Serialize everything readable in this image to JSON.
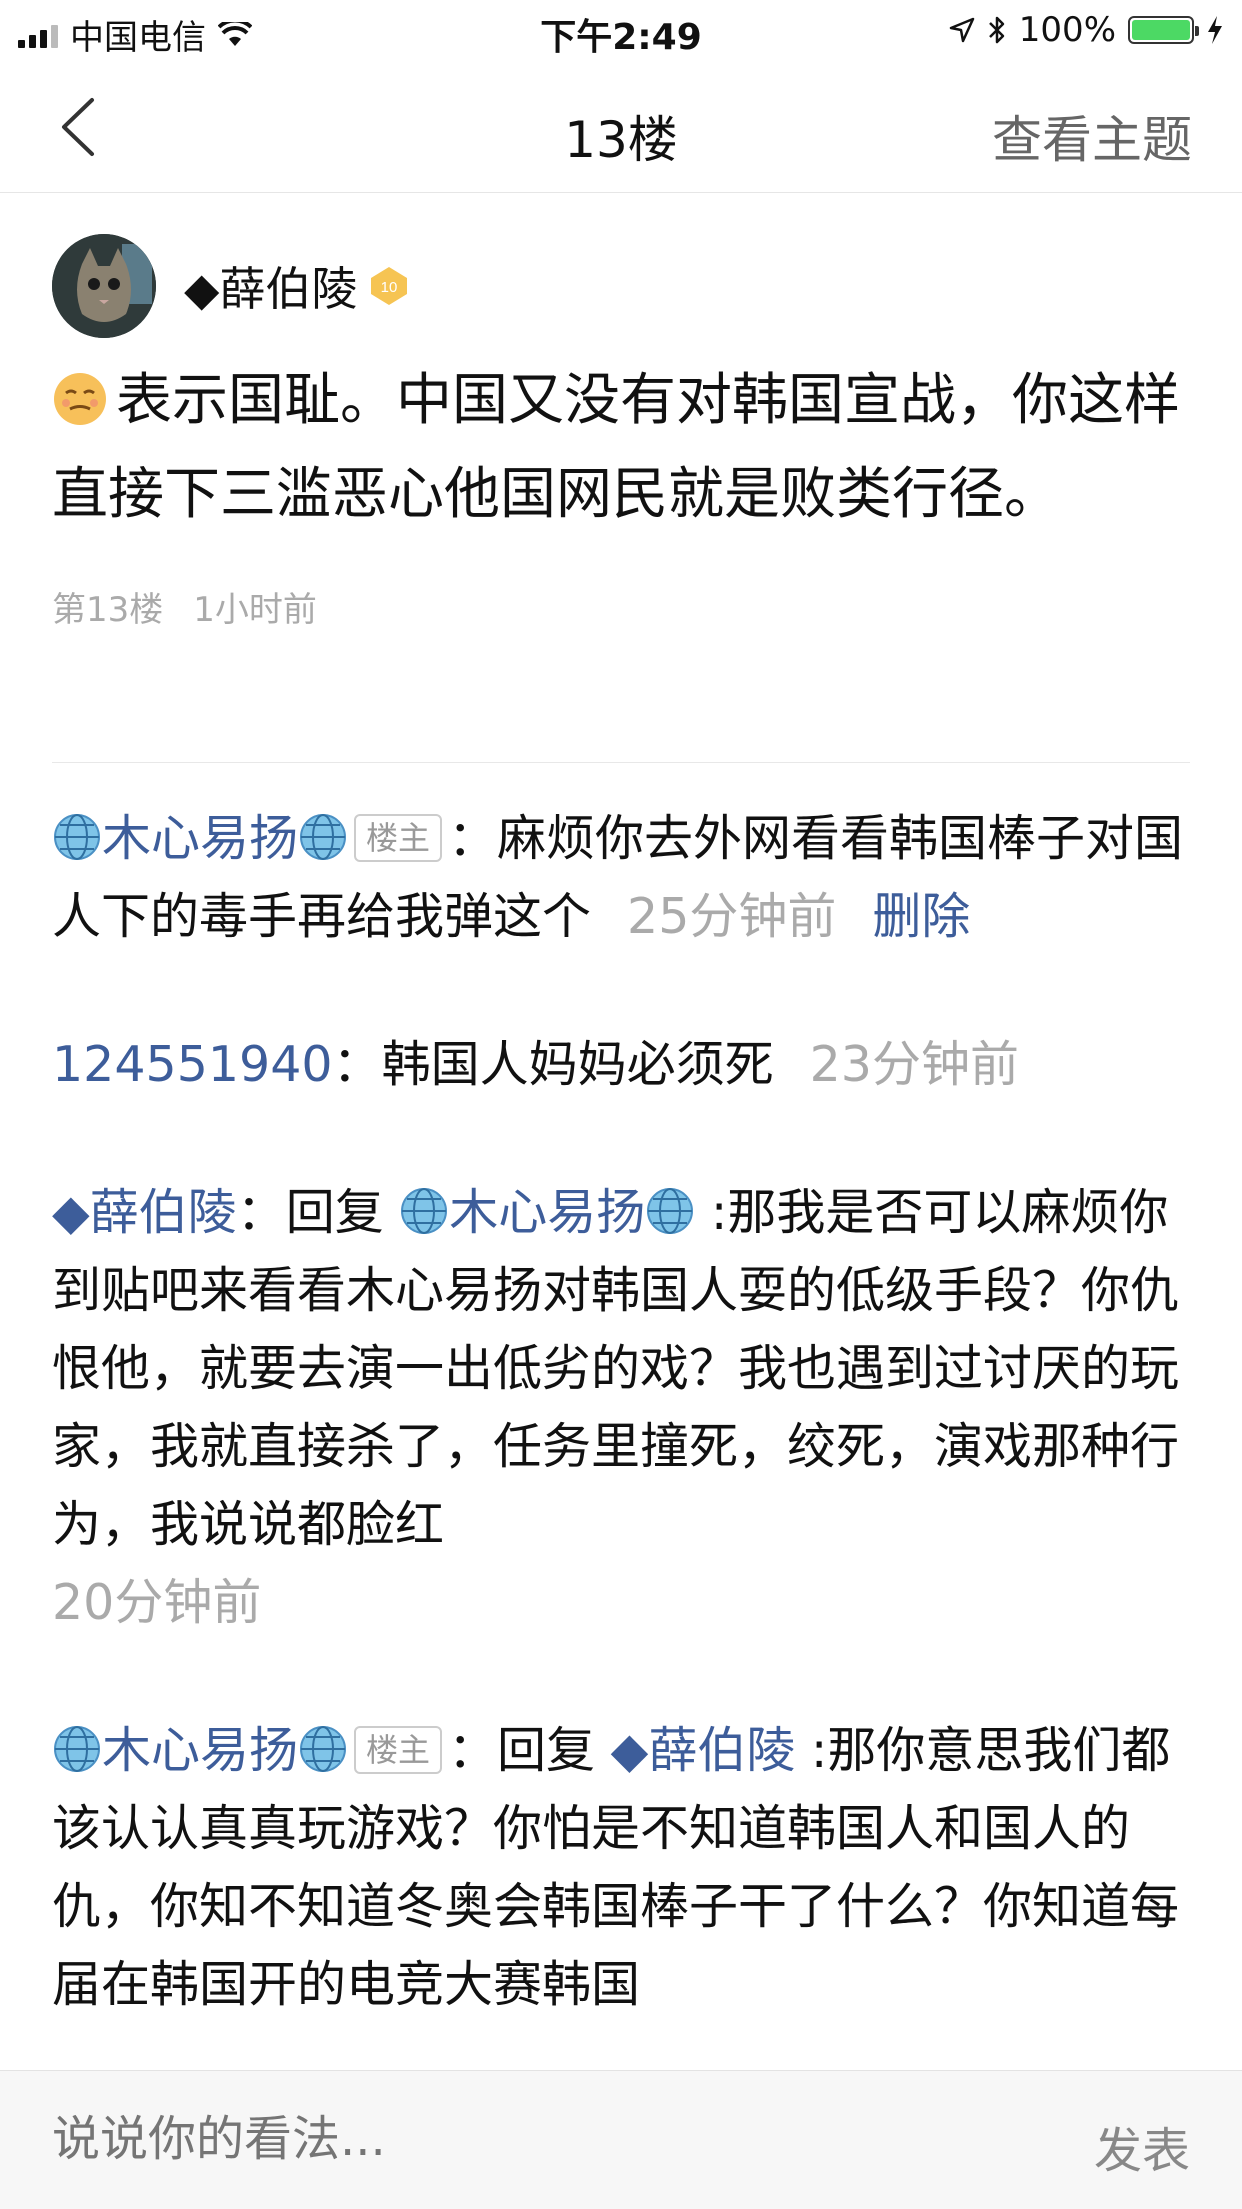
{
  "status_bar": {
    "carrier": "中国电信",
    "time": "下午2:49",
    "battery": "100%",
    "battery_level": 1.0
  },
  "nav": {
    "title": "13楼",
    "right_action": "查看主题"
  },
  "post": {
    "author": "◆薛伯陵",
    "level": "10",
    "text": "表示国耻。中国又没有对韩国宣战，你这样直接下三滥恶心他国网民就是败类行径。",
    "floor": "第13楼",
    "time": "1小时前"
  },
  "comments": [
    {
      "user": "木心易扬",
      "tag": "楼主",
      "text": "麻烦你去外网看看韩国棒子对国人下的毒手再给我弹这个",
      "time": "25分钟前",
      "delete": "删除"
    },
    {
      "user": "124551940",
      "text": "韩国人妈妈必须死",
      "time": "23分钟前"
    },
    {
      "user": "◆薛伯陵",
      "reply_word": "回复",
      "reply_to": "木心易扬",
      "text": ":那我是否可以麻烦你到贴吧来看看木心易扬对韩国人耍的低级手段？你仇恨他，就要去演一出低劣的戏？我也遇到过讨厌的玩家，我就直接杀了，任务里撞死，绞死，演戏那种行为，我说说都脸红",
      "time": "20分钟前"
    },
    {
      "user": "木心易扬",
      "tag": "楼主",
      "reply_word": "回复",
      "reply_to": "◆薛伯陵",
      "text": ":那你意思我们都该认认真真玩游戏？你怕是不知道韩国人和国人的仇，你知不知道冬奥会韩国棒子干了什么？你知道每届在韩国开的电竞大赛韩国"
    }
  ],
  "input": {
    "placeholder": "说说你的看法...",
    "send_label": "发表"
  },
  "colors": {
    "link": "#3d5d9a",
    "muted": "#aaaaaa",
    "battery": "#4cd964"
  }
}
